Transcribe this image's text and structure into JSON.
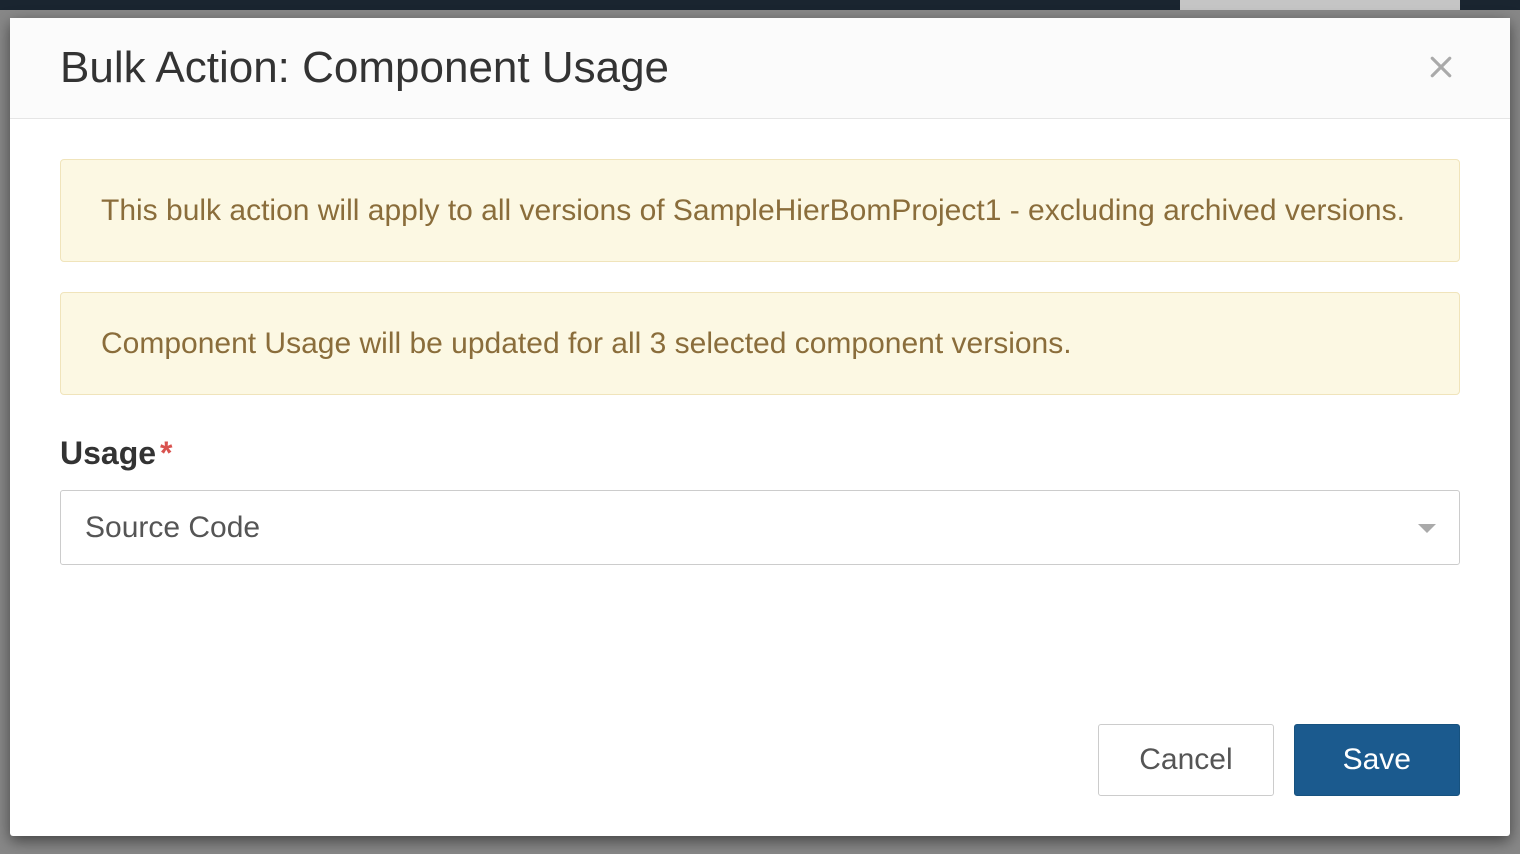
{
  "modal": {
    "title": "Bulk Action: Component Usage",
    "alerts": {
      "scope": "This bulk action will apply to all versions of SampleHierBomProject1 - excluding archived versions.",
      "count": "Component Usage will be updated for all 3 selected component versions."
    },
    "form": {
      "usage_label": "Usage",
      "usage_value": "Source Code"
    },
    "buttons": {
      "cancel": "Cancel",
      "save": "Save"
    }
  }
}
